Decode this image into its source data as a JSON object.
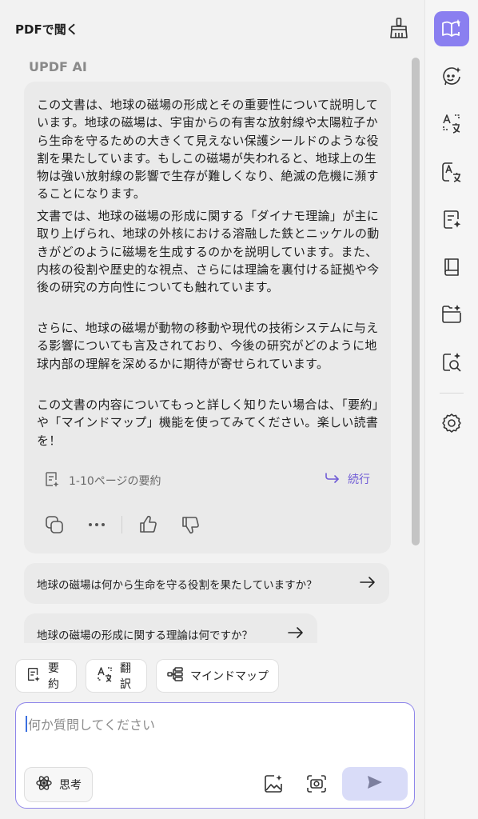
{
  "header": {
    "title": "PDFで聞く",
    "clean_icon": "broom-icon"
  },
  "message": {
    "ai_name": "UPDF AI",
    "paragraphs": [
      "この文書は、地球の磁場の形成とその重要性について説明しています。地球の磁場は、宇宙からの有害な放射線や太陽粒子から生命を守るための大きくて見えない保護シールドのような役割を果たしています。もしこの磁場が失われると、地球上の生物は強い放射線の影響で生存が難しくなり、絶滅の危機に瀕することになります。",
      "文書では、地球の磁場の形成に関する「ダイナモ理論」が主に取り上げられ、地球の外核における溶融した鉄とニッケルの動きがどのように磁場を生成するのかを説明しています。また、内核の役割や歴史的な視点、さらには理論を裏付ける証拠や今後の研究の方向性についても触れています。",
      "さらに、地球の磁場が動物の移動や現代の技術システムに与える影響についても言及されており、今後の研究がどのように地球内部の理解を深めるかに期待が寄せられています。",
      "この文書の内容についてもっと詳しく知りたい場合は、「要約」や「マインドマップ」機能を使ってみてください。楽しい読書を！"
    ],
    "summary_label": "1-10ページの要約",
    "continue_label": "続行"
  },
  "suggestions": [
    "地球の磁場は何から生命を守る役割を果たしていますか？",
    "地球の磁場の形成に関する理論は何ですか？"
  ],
  "chips": {
    "summarize": "要約",
    "translate": "翻訳",
    "mindmap": "マインドマップ"
  },
  "input": {
    "placeholder": "何か質問してください",
    "think_label": "思考"
  },
  "rail": {
    "items": [
      "book-sparkle-icon",
      "chat-face-icon",
      "translate-icon",
      "translate-box-icon",
      "summary-icon",
      "book-icon",
      "folder-sparkle-icon",
      "search-doc-icon",
      "settings-icon"
    ]
  },
  "colors": {
    "accent": "#8a7ff0",
    "link": "#6f5bd6",
    "send_bg": "#d9dcf8"
  }
}
